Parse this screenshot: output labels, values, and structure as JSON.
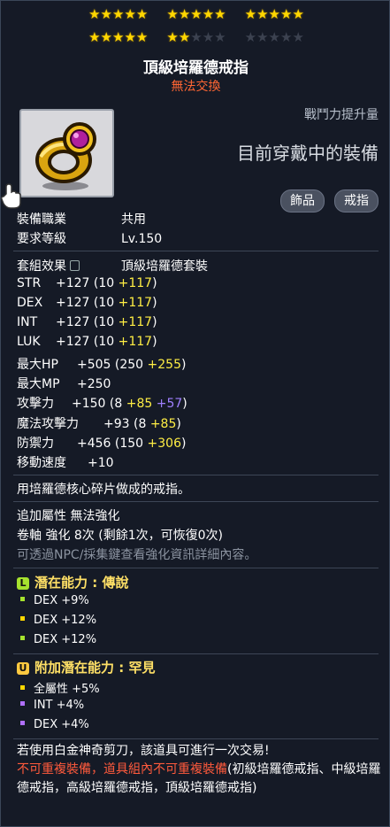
{
  "stars": {
    "row1": [
      5,
      5,
      5
    ],
    "row2": [
      5,
      2,
      0
    ],
    "filled_color": "#ffd700",
    "empty_color": "#3c4250"
  },
  "item": {
    "name": "頂級培羅德戒指",
    "trade": "無法交換",
    "icon": "gold-ring-purple-gem-icon"
  },
  "header": {
    "power_label": "戰鬥力提升量",
    "equipped": "目前穿戴中的裝備",
    "tags": [
      "飾品",
      "戒指"
    ]
  },
  "requirements": [
    {
      "label": "裝備職業",
      "value": "共用"
    },
    {
      "label": "要求等級",
      "value": "Lv.150"
    }
  ],
  "set": {
    "label": "套組效果",
    "value": "頂級培羅德套裝"
  },
  "stats": [
    {
      "name": "STR",
      "base": "+127 (10 ",
      "bonus": "+117",
      "extra": "",
      "tail": ")"
    },
    {
      "name": "DEX",
      "base": "+127 (10 ",
      "bonus": "+117",
      "extra": "",
      "tail": ")"
    },
    {
      "name": "INT",
      "base": "+127 (10 ",
      "bonus": "+117",
      "extra": "",
      "tail": ")"
    },
    {
      "name": "LUK",
      "base": "+127 (10 ",
      "bonus": "+117",
      "extra": "",
      "tail": ")"
    },
    {
      "name": "最大HP",
      "base": "+505 (250 ",
      "bonus": "+255",
      "extra": "",
      "tail": ")"
    },
    {
      "name": "最大MP",
      "base": "+250",
      "bonus": "",
      "extra": "",
      "tail": ""
    },
    {
      "name": "攻擊力",
      "base": "+150 (8 ",
      "bonus": "+85",
      "extra": " +57",
      "tail": ")"
    },
    {
      "name": "魔法攻擊力",
      "base": "+93 (8 ",
      "bonus": "+85",
      "extra": "",
      "tail": ")"
    },
    {
      "name": "防禦力",
      "base": "+456 (150 ",
      "bonus": "+306",
      "extra": "",
      "tail": ")"
    },
    {
      "name": "移動速度",
      "base": "+10",
      "bonus": "",
      "extra": "",
      "tail": ""
    }
  ],
  "description": "用培羅德核心碎片做成的戒指。",
  "additional": {
    "line1": "追加屬性 無法強化",
    "line2": "卷軸 強化 8次 (剩餘1次，可恢復0次)",
    "hint": "可透過NPC/採集鍵查看強化資訊詳細內容。"
  },
  "potential": {
    "title": "潛在能力 : 傳說",
    "badge": "L",
    "lines": [
      "DEX +9%",
      "DEX +12%",
      "DEX +12%"
    ]
  },
  "bonus_potential": {
    "title": "附加潛在能力 : 罕見",
    "badge": "U",
    "lines": [
      "全屬性 +5%",
      "INT +4%",
      "DEX +4%"
    ]
  },
  "footer": {
    "line1": "若使用白金神奇剪刀，該道具可進行一次交易!",
    "red": "不可重複裝備，道具組內不可重複裝備",
    "rest": "(初級培羅德戒指、中級培羅德戒指，高級培羅德戒指，頂級培羅德戒指)"
  }
}
